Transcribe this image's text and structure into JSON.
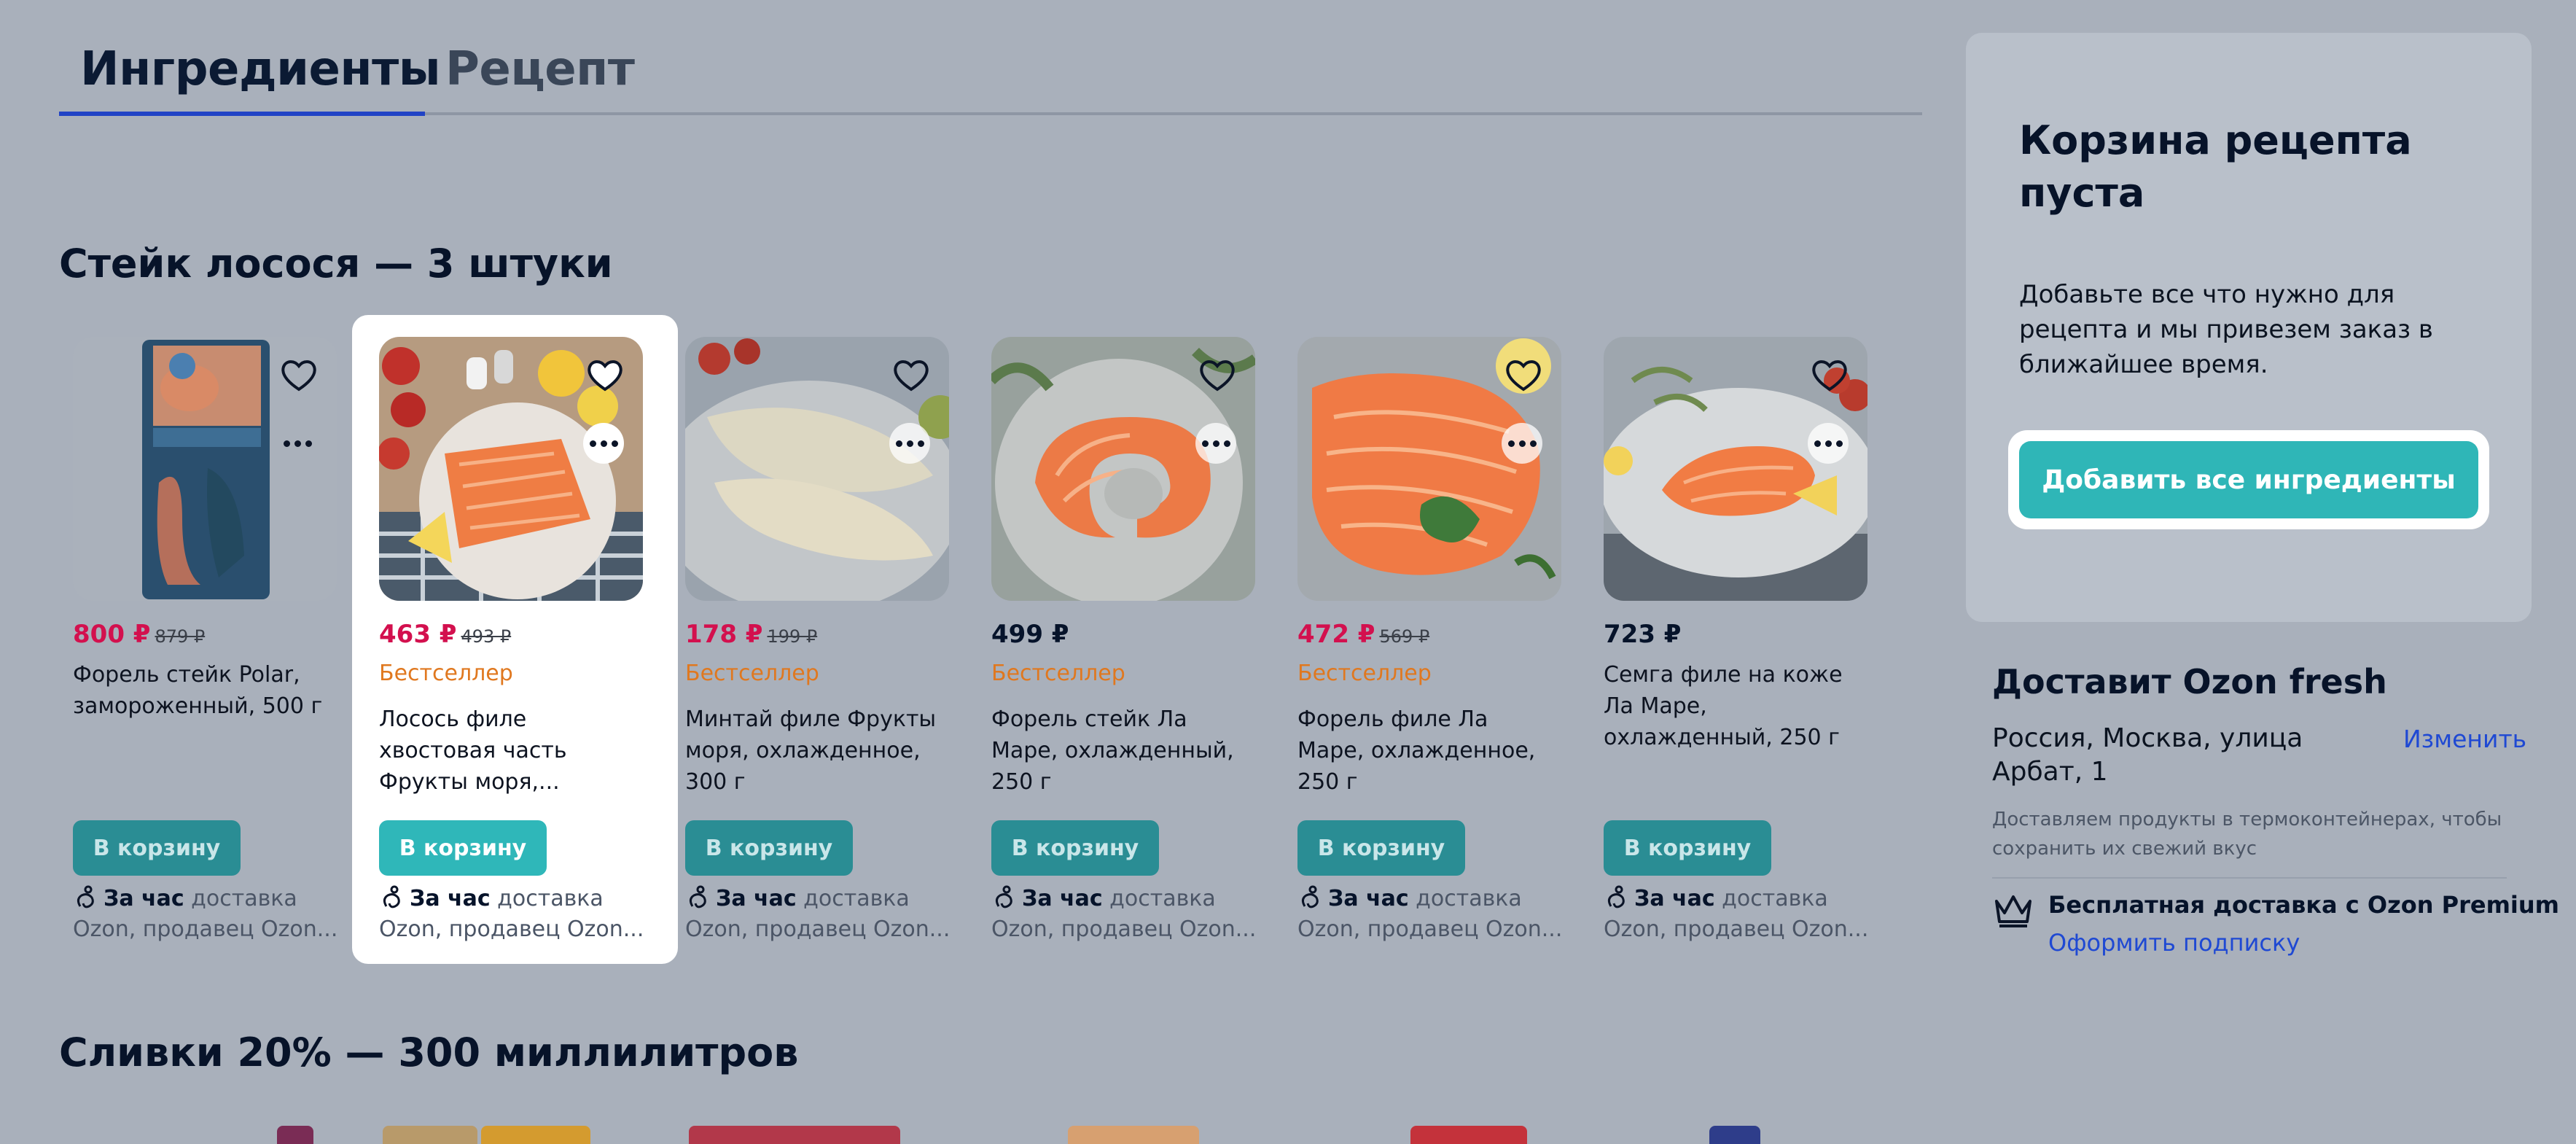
{
  "tabs": {
    "ingredients": "Ингредиенты",
    "recipe": "Рецепт"
  },
  "sections": {
    "salmon": "Стейк лосося — 3 штуки",
    "cream": "Сливки 20% — 300 миллилитров"
  },
  "products": [
    {
      "price": "800 ₽",
      "old_price": "879 ₽",
      "badge": "",
      "name_lines": [
        "Форель стейк Polar,",
        "замороженный, 500 г",
        ""
      ],
      "cart": "В корзину",
      "delivery_bold": "За час",
      "delivery_rest": " доставка",
      "seller": "Ozon, продавец Ozon..."
    },
    {
      "price": "463 ₽",
      "old_price": "493 ₽",
      "badge": "Бестселлер",
      "name_lines": [
        "Лосось филе",
        "хвостовая часть",
        "Фрукты моря,..."
      ],
      "cart": "В корзину",
      "delivery_bold": "За час",
      "delivery_rest": " доставка",
      "seller": "Ozon, продавец Ozon..."
    },
    {
      "price": "178 ₽",
      "old_price": "199 ₽",
      "badge": "Бестселлер",
      "name_lines": [
        "Минтай филе Фрукты",
        "моря, охлажденное,",
        "300 г"
      ],
      "cart": "В корзину",
      "delivery_bold": "За час",
      "delivery_rest": " доставка",
      "seller": "Ozon, продавец Ozon..."
    },
    {
      "price": "499 ₽",
      "old_price": "",
      "badge": "Бестселлер",
      "name_lines": [
        "Форель стейк Ла",
        "Маре, охлажденный,",
        "250 г"
      ],
      "cart": "В корзину",
      "delivery_bold": "За час",
      "delivery_rest": " доставка",
      "seller": "Ozon, продавец Ozon..."
    },
    {
      "price": "472 ₽",
      "old_price": "569 ₽",
      "badge": "Бестселлер",
      "name_lines": [
        "Форель филе Ла",
        "Маре, охлажденное,",
        "250 г"
      ],
      "cart": "В корзину",
      "delivery_bold": "За час",
      "delivery_rest": " доставка",
      "seller": "Ozon, продавец Ozon..."
    },
    {
      "price": "723 ₽",
      "old_price": "",
      "badge": "",
      "name_lines": [
        "Семга филе на коже",
        "Ла Маре,",
        "охлажденный, 250 г"
      ],
      "cart": "В корзину",
      "delivery_bold": "За час",
      "delivery_rest": " доставка",
      "seller": "Ozon, продавец Ozon..."
    }
  ],
  "cart_panel": {
    "title": "Корзина рецепта пуста",
    "description": "Добавьте все что нужно для рецепта и мы привезем заказ в ближайшее время.",
    "add_all": "Добавить все ингредиенты"
  },
  "delivery": {
    "title": "Доставит Ozon fresh",
    "address": "Россия, Москва, улица Арбат, 1",
    "change": "Изменить",
    "note": "Доставляем продукты в термоконтейнерах, чтобы сохранить их свежий вкус",
    "premium": "Бесплатная доставка с Ozon Premium",
    "subscribe": "Оформить подписку"
  },
  "colors": {
    "discount_price": "#d3104e",
    "bestseller": "#e0781f",
    "cart_button": "#2fb7b9",
    "link": "#1f49d3"
  },
  "icons": [
    "heart-icon",
    "more-icon",
    "running-icon",
    "crown-icon"
  ]
}
